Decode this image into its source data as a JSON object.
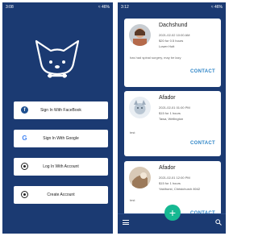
{
  "left_screen": {
    "status_time": "3:08",
    "status_right": "≈ 46%",
    "buttons": [
      {
        "label": "Sign In With FaceBook",
        "icon": "facebook-icon"
      },
      {
        "label": "Sign In With Google",
        "icon": "google-icon"
      },
      {
        "label": "Log In With Account",
        "icon": "account-icon"
      },
      {
        "label": "Create Account",
        "icon": "account-icon"
      }
    ]
  },
  "right_screen": {
    "status_time": "3:12",
    "status_right": "≈ 46%",
    "cards": [
      {
        "name": "Dachshund",
        "datetime": "2021-02-02 10:00 AM",
        "price": "$20 for 0.5 hours",
        "location": "Lower Hutt",
        "note": "has had spinal surgery, may be lazy",
        "contact": "CONTACT"
      },
      {
        "name": "Afador",
        "datetime": "2021-02-01 01:00 PM",
        "price": "$15 for 1 hours",
        "location": "Tawa, Wellington",
        "note": "test",
        "contact": "CONTACT"
      },
      {
        "name": "Afador",
        "datetime": "2021-02-01 12:00 PM",
        "price": "$15 for 1 hours",
        "location": "Yaldhurst, Christchurch 8042",
        "note": "test",
        "contact": "CONTACT"
      }
    ],
    "fab_label": "+"
  },
  "colors": {
    "background_navy": "#1b3a72",
    "accent_teal": "#16b892",
    "contact_blue": "#2e85c7"
  }
}
